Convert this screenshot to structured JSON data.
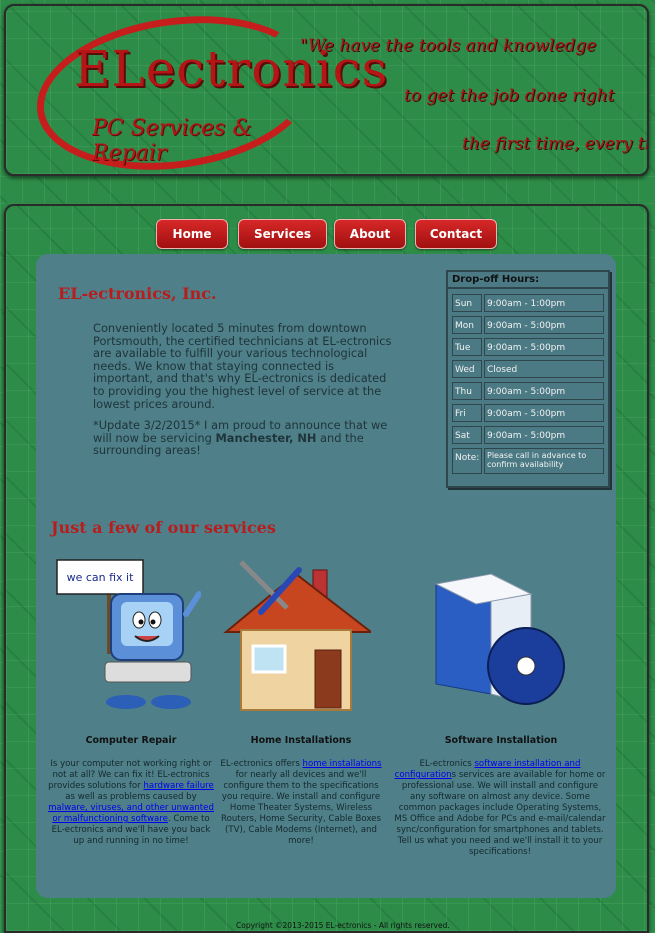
{
  "header": {
    "logo_title": "ELectronics",
    "logo_subtitle": "PC Services & Repair",
    "tagline": [
      "\"We have the tools and knowledge",
      "to get the job done right",
      "the first time, every time.\""
    ]
  },
  "nav": [
    "Home",
    "Services",
    "About",
    "Contact"
  ],
  "company_heading": "EL-ectronics, Inc.",
  "intro": {
    "paragraph1": "Conveniently located 5 minutes from downtown Portsmouth, the certified technicians at EL-ectronics are available to fulfill your various technological needs. We know that staying connected is important, and that's why EL-ectronics is dedicated to providing you the highest level of service at the lowest prices around.",
    "update_label": "*Update 3/2/2015*",
    "update_text_1": " I am proud to announce that we will now be servicing ",
    "update_location": "Manchester, NH",
    "update_text_2": " and the surrounding areas!"
  },
  "hours": {
    "title": "Drop-off Hours:",
    "rows": [
      {
        "day": "Sun",
        "time": "9:00am - 1:00pm"
      },
      {
        "day": "Mon",
        "time": "9:00am - 5:00pm"
      },
      {
        "day": "Tue",
        "time": "9:00am - 5:00pm"
      },
      {
        "day": "Wed",
        "time": "Closed"
      },
      {
        "day": "Thu",
        "time": "9:00am - 5:00pm"
      },
      {
        "day": "Fri",
        "time": "9:00am - 5:00pm"
      },
      {
        "day": "Sat",
        "time": "9:00am - 5:00pm"
      },
      {
        "day": "Note:",
        "time": "Please call in advance to confirm availability"
      }
    ]
  },
  "services_heading": "Just a few of our services",
  "sign_text": "we can fix it",
  "services": [
    {
      "title": "Computer Repair",
      "t1": "Is your computer not working right or not at all? We can fix it! EL-ectronics provides solutions for ",
      "link1": "hardware failure",
      "t2": " as well as problems caused by ",
      "link2": "malware, viruses, and other unwanted or malfunctioning software",
      "t3": ". Come to EL-ectronics and we'll have you back up and running in no time!"
    },
    {
      "title": "Home Installations",
      "t1": "EL-ectronics offers ",
      "link1": "home installations",
      "t2": " for nearly all devices and we'll configure them to the specifications you require. We install and configure Home Theater Systems, Wireless Routers, Home Security, Cable Boxes (TV), Cable Modems (Internet), and more!"
    },
    {
      "title": "Software Installation",
      "t1": "EL-ectronics ",
      "link1": "software installation and configuration",
      "t2": "s services are available for home or professional use. We will install and configure any software on almost any device. Some common packages include Operating Systems, MS Office and Adobe for PCs and e-mail/calendar sync/configuration for smartphones and tablets. Tell us what you need and we'll install it to your specifications!"
    }
  ],
  "footer": "Copyright ©2013-2015 EL-ectronics - All rights reserved.",
  "colors": {
    "accent_red": "#b81d1d",
    "panel": "#4f7f89",
    "pcb_green": "#2d8d48"
  }
}
